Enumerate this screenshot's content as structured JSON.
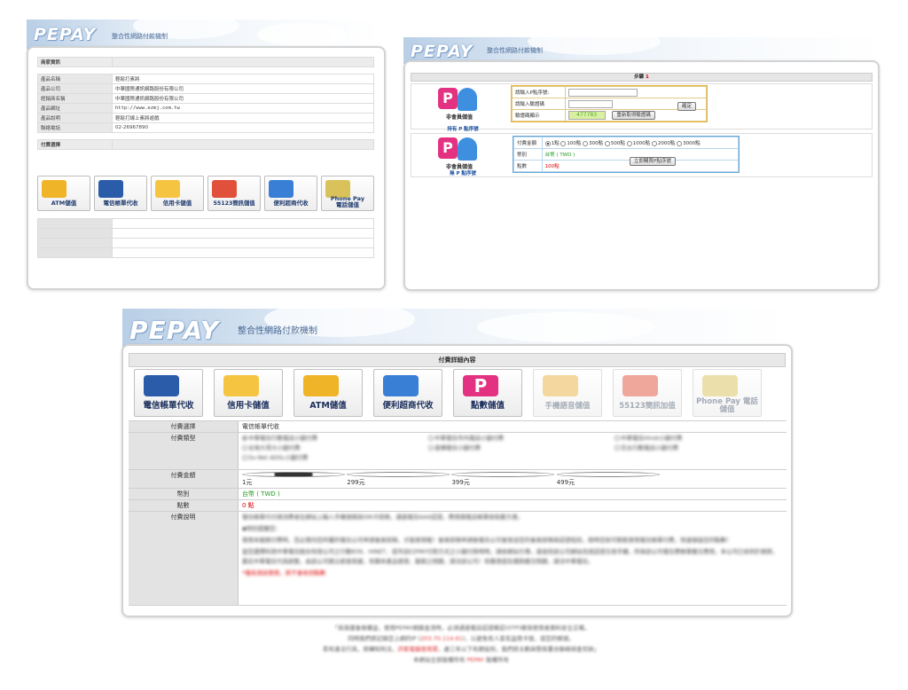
{
  "banner": {
    "logo": "PEPAY",
    "subtitle": "整合性網路付款機制"
  },
  "panel1": {
    "merchant_header": "商家資訊",
    "info_rows": [
      {
        "label": "產品名稱",
        "value": "輕鬆打素將"
      },
      {
        "label": "產品公司",
        "value": "中華國際通訊網路股份有限公司"
      },
      {
        "label": "經銷商名稱",
        "value": "中華國際通訊網路股份有限公司"
      },
      {
        "label": "產品網址",
        "value": "http://www.ezmj.com.tw"
      },
      {
        "label": "產品說明",
        "value": "輕鬆打線上素將遊戲"
      },
      {
        "label": "聯絡電話",
        "value": "02-26967890"
      }
    ],
    "payment_header": "付費選擇",
    "buttons": [
      {
        "label": "ATM儲值",
        "color": "#f0b428"
      },
      {
        "label": "電信帳單代收",
        "color": "#2a5caa"
      },
      {
        "label": "信用卡儲值",
        "color": "#f5c542"
      },
      {
        "label": "55123簡訊儲值",
        "color": "#e0503a"
      },
      {
        "label": "便利超商代收",
        "color": "#3a7fd6"
      },
      {
        "label": "Phone Pay",
        "label2": "電話儲值",
        "color": "#d9c25a"
      }
    ]
  },
  "panel2": {
    "step_label": "步驟",
    "step_num": "1",
    "block1": {
      "icon_label": "非會員儲值",
      "sub": "持有 P 點序號",
      "rows": [
        {
          "label": "請輸入P點序號:"
        },
        {
          "label": "請輸入驗證碼"
        },
        {
          "label": "驗證碼顯示"
        }
      ],
      "captcha": "477783",
      "refresh_btn": "重新取得驗證碼",
      "confirm_btn": "確定"
    },
    "block2": {
      "icon_label": "非會員儲值",
      "sub": "無 P 點序號",
      "amount_label": "付費金額",
      "amounts": [
        "1點",
        "100點",
        "300點",
        "500點",
        "1000點",
        "2000點",
        "3000點"
      ],
      "currency_label": "幣別",
      "currency_value": "台幣 ( TWD )",
      "points_label": "點數",
      "points_value": "100點",
      "buy_btn": "立即購買P點序號"
    }
  },
  "panel3": {
    "header": "付費詳細內容",
    "icons": [
      {
        "label": "電信帳單代收",
        "color": "#2a5caa",
        "dim": false
      },
      {
        "label": "信用卡儲值",
        "color": "#f5c542",
        "dim": false
      },
      {
        "label": "ATM儲值",
        "color": "#f0b428",
        "dim": false
      },
      {
        "label": "便利超商代收",
        "color": "#3a7fd6",
        "dim": false
      },
      {
        "label": "點數儲值",
        "color": "#e33282",
        "dim": false
      },
      {
        "label": "手機語音儲值",
        "color": "#e8b040",
        "dim": true
      },
      {
        "label": "55123簡訊加值",
        "color": "#e0503a",
        "dim": true
      },
      {
        "label": "Phone Pay 電話儲值",
        "color": "#d9c25a",
        "dim": true
      }
    ],
    "rows": {
      "choice_label": "付費選擇",
      "choice_value": "電信帳單代收",
      "type_label": "付費類型",
      "types": [
        "中華電信行動電話小額付費",
        "中華電信市內電話小額付費",
        "中華電信Hinet小額付費",
        "台灣大哥大小額付費",
        "遠傳電信小額付費",
        "亞太行動電話小額付費",
        "So-Net ADSL小額付費"
      ],
      "amount_label": "付費金額",
      "amounts": [
        "1元",
        "299元",
        "399元",
        "499元"
      ],
      "currency_label": "幣別",
      "currency_value": "台幣 ( TWD )",
      "points_label": "點數",
      "points_value": "0 點",
      "desc_label": "付費說明",
      "desc_lines": [
        "電信帳單代付請消費者在網站上輸入手機號碼與SIN卡密碼，通過電信AAA認證，費用隨電話帳單收取最方便。",
        "◆特別提醒您：",
        "使用本服務付費時，您必需向您所屬的電信公司申請會員密碼，才能使用喔！會員密碼申請後電信公司會發送您的會員密碼與認證短訊，屆時您就可輕鬆使用電信帳單付費，快速儲值您的點數！",
        "當您選擇利用中華電信股份有限公司之行動839、HINET、或市話EZPAY付款方式之小額付款時時，請依網站引導，直接到該公司網站完成認證交易手續，所與該公司電信費帳單繳交費用，本公司已依刑於網頁，委託中華電信代爲統整，由該公司開立統發表據，有關本產品使用、服務之問題，請洽該公司！有關憑證及價款繳交問題，請洽中華電信。",
        "*僅爲測試使用，將不會收到點數"
      ]
    }
  },
  "footer": {
    "line1": "「爲保護會員權益，使用PEPAY網路金流時，必須通過電話認證確認(OTP)確保使用者資料安全正確。",
    "line2a": "同時我們將記錄您上網的IP (",
    "line2_ip": "203.70.114.61",
    "line2b": ")，以避免有人冒名盜用卡號，或您的帳號。",
    "line3a": "若有違法行爲，將轉知刑法，",
    "line3_warn": "詐欺電腦使用罪",
    "line3b": "，處三年以下有期徒刑，我們將主動與警政署合聯絡偵查究辦」",
    "line4a": "本網站全部版權所有 ",
    "line4_brand": "PEPAY",
    "line4b": " 版權所有"
  }
}
